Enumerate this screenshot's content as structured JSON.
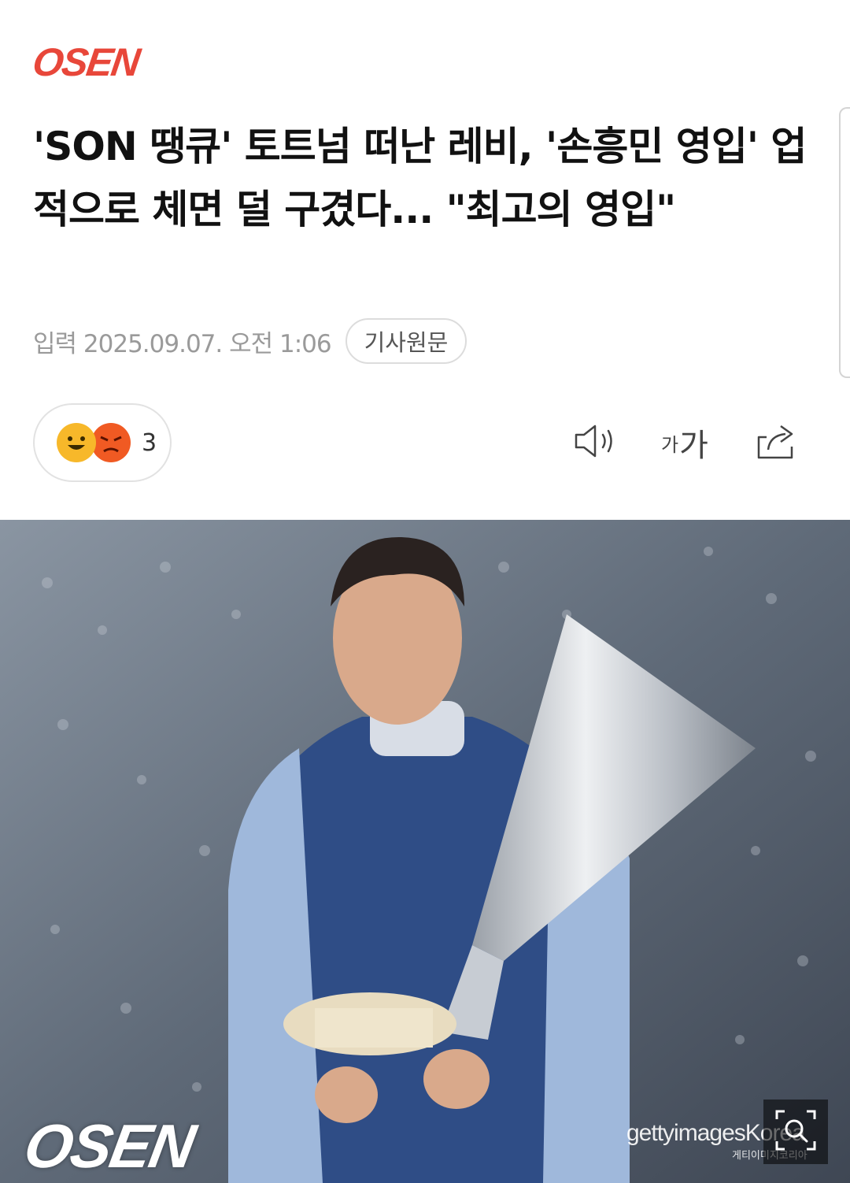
{
  "brand": {
    "logo_text": "OSEN",
    "color": "#e8473a"
  },
  "article": {
    "headline": "'SON 땡큐' 토트넘 떠난 레비, '손흥민 영입' 업적으로 체면 덜 구겼다... \"최고의 영입\"",
    "meta": "입력 2025.09.07. 오전 1:06",
    "original_link_label": "기사원문"
  },
  "reactions": {
    "count": "3",
    "icons": [
      "happy-face-icon",
      "angry-face-icon"
    ]
  },
  "toolbar": {
    "font_small": "가",
    "font_large": "가",
    "icons": [
      "speaker-icon",
      "font-size-icon",
      "share-icon"
    ]
  },
  "photo": {
    "watermark_brand": "OSEN",
    "credit": "gettyimagesKorea",
    "credit_sub": "게티이미지코리아",
    "zoom_icon": "zoom-icon"
  }
}
